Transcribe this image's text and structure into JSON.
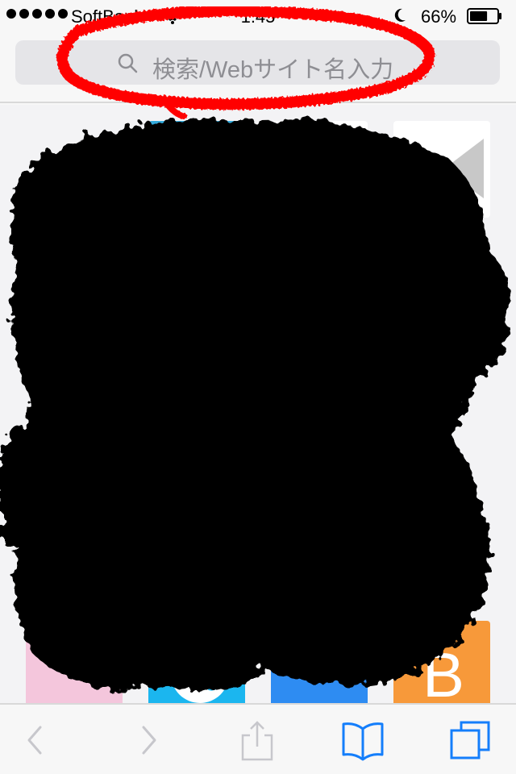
{
  "status_bar": {
    "carrier": "SoftBank",
    "time": "1:45",
    "battery_percent": "66%",
    "battery_level": 0.66,
    "signal_dots": 5
  },
  "address_bar": {
    "placeholder": "検索/Webサイト名入力"
  },
  "favorites": {
    "visible_tile_letter": "B"
  },
  "toolbar": {
    "back_icon": "chevron-left-icon",
    "forward_icon": "chevron-right-icon",
    "share_icon": "share-icon",
    "bookmarks_icon": "book-icon",
    "tabs_icon": "tabs-icon"
  },
  "colors": {
    "accent": "#147efb",
    "annotation": "#ff0000",
    "redaction": "#000000",
    "disabled": "#c7c7cc"
  }
}
